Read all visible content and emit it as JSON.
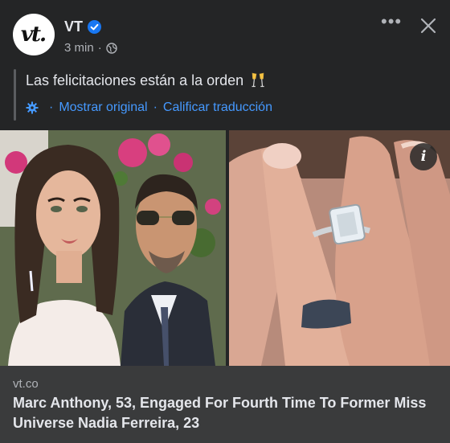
{
  "post": {
    "author": "VT",
    "avatar_text": "vt.",
    "time": "3 min",
    "meta_separator": "·",
    "text": "Las felicitaciones están a la orden",
    "translation": {
      "show_original": "Mostrar original",
      "rate_translation": "Calificar traducción",
      "separator": "·"
    },
    "more_label": "•••"
  },
  "media": {
    "info_label": "i"
  },
  "link_preview": {
    "domain": "vt.co",
    "headline": "Marc Anthony, 53, Engaged For Fourth Time To Former Miss Universe Nadia Ferreira, 23"
  },
  "icons": {
    "verified": "verified-badge-icon",
    "globe": "globe-icon",
    "gear": "gear-icon",
    "champagne": "champagne-glasses-icon",
    "more": "more-options-icon",
    "close": "close-icon",
    "info": "info-icon"
  },
  "colors": {
    "background": "#242526",
    "preview_background": "#3a3b3c",
    "link": "#4599ff",
    "verified": "#1877f2"
  }
}
